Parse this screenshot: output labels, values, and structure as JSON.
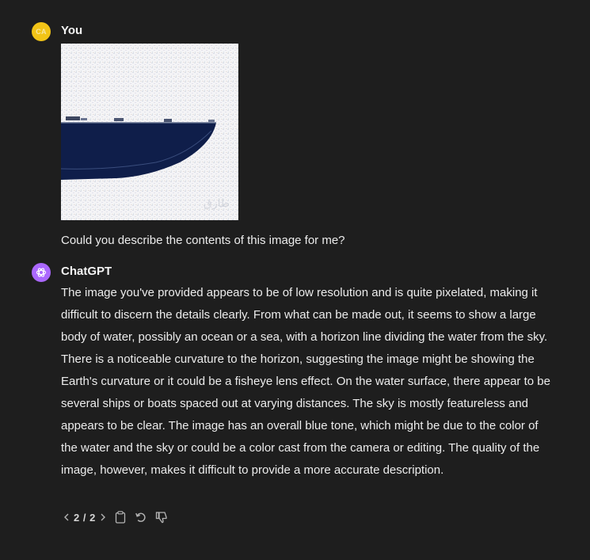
{
  "user_message": {
    "avatar_initials": "CA",
    "author": "You",
    "text": "Could you describe the contents of this image for me?"
  },
  "assistant_message": {
    "author": "ChatGPT",
    "text": "The image you've provided appears to be of low resolution and is quite pixelated, making it difficult to discern the details clearly. From what can be made out, it seems to show a large body of water, possibly an ocean or a sea, with a horizon line dividing the water from the sky. There is a noticeable curvature to the horizon, suggesting the image might be showing the Earth's curvature or it could be a fisheye lens effect. On the water surface, there appear to be several ships or boats spaced out at varying distances. The sky is mostly featureless and appears to be clear. The image has an overall blue tone, which might be due to the color of the water and the sky or could be a color cast from the camera or editing. The quality of the image, however, makes it difficult to provide a more accurate description.",
    "pager": "2 / 2"
  },
  "icons": {
    "prev": "chevron-left-icon",
    "next": "chevron-right-icon",
    "copy": "clipboard-icon",
    "regenerate": "refresh-icon",
    "feedback": "thumbs-down-icon",
    "assistant_avatar": "openai-logo-icon"
  },
  "colors": {
    "background": "#1e1e1e",
    "user_avatar": "#f2c417",
    "assistant_avatar": "#ab68ff",
    "water": "#0f1e4a"
  }
}
